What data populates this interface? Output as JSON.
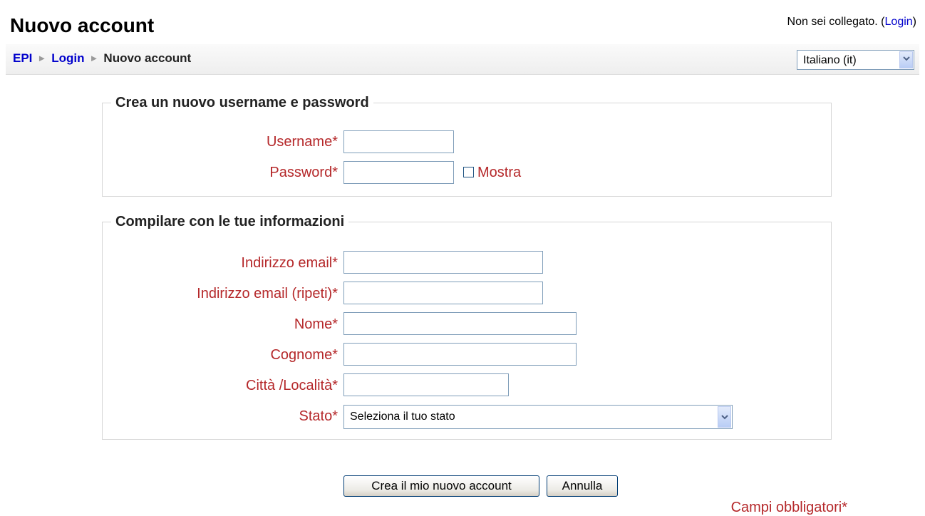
{
  "header": {
    "title": "Nuovo account",
    "login_status_prefix": "Non sei collegato. (",
    "login_link": "Login",
    "login_status_suffix": ")"
  },
  "breadcrumb": {
    "items": [
      "EPI",
      "Login",
      "Nuovo account"
    ],
    "separator": "►"
  },
  "language_select": {
    "selected": "Italiano (it)"
  },
  "section_account": {
    "legend": "Crea un nuovo username e password",
    "username_label": "Username*",
    "username_value": "",
    "password_label": "Password*",
    "password_value": "",
    "show_password_label": "Mostra",
    "show_password_checked": false
  },
  "section_info": {
    "legend": "Compilare con le tue informazioni",
    "email_label": "Indirizzo email*",
    "email_value": "",
    "email_repeat_label": "Indirizzo email (ripeti)*",
    "email_repeat_value": "",
    "firstname_label": "Nome*",
    "firstname_value": "",
    "lastname_label": "Cognome*",
    "lastname_value": "",
    "city_label": "Città /Località*",
    "city_value": "",
    "country_label": "Stato*",
    "country_selected": "Seleziona il tuo stato"
  },
  "buttons": {
    "submit": "Crea il mio nuovo account",
    "cancel": "Annulla"
  },
  "required_note": "Campi obbligatori*",
  "colors": {
    "required_label": "#b5282a",
    "link": "#0000cc",
    "border": "#7f9db9"
  },
  "icons": {
    "breadcrumb_separator": "triangle-right-icon",
    "dropdown": "chevron-down-icon"
  }
}
